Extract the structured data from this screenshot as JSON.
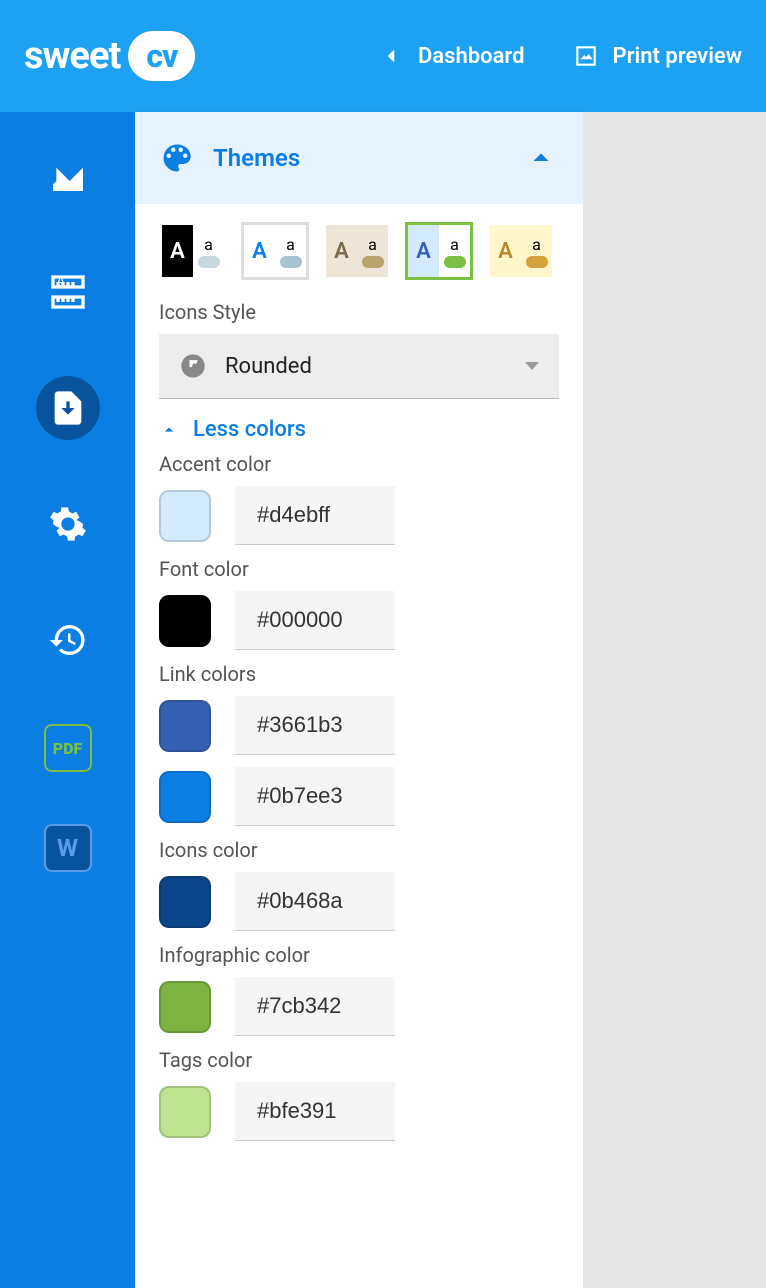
{
  "header": {
    "logo_text": "sweet",
    "logo_badge": "cv",
    "dashboard": "Dashboard",
    "print_preview": "Print preview"
  },
  "panel": {
    "title": "Themes",
    "icons_style_label": "Icons Style",
    "icons_style_value": "Rounded",
    "less_colors": "Less colors",
    "themes": [
      {
        "leftBg": "#000000",
        "leftColor": "#ffffff",
        "rightBg": "#ffffff",
        "pillBg": "#c7d7dd"
      },
      {
        "leftBg": "#ffffff",
        "leftColor": "#0b7ee3",
        "rightBg": "#ffffff",
        "pillBg": "#a8c3d0",
        "border": "#ddd"
      },
      {
        "leftBg": "#ece5d8",
        "leftColor": "#7a6b4f",
        "rightBg": "#ece5d8",
        "pillBg": "#b8a56b"
      },
      {
        "leftBg": "#d4ebff",
        "leftColor": "#3661b3",
        "rightBg": "#ffffff",
        "pillBg": "#7bc043",
        "selected": true
      },
      {
        "leftBg": "#fff6cc",
        "leftColor": "#b88a2b",
        "rightBg": "#fff6cc",
        "pillBg": "#d4a13a"
      }
    ],
    "colors": [
      {
        "label": "Accent color",
        "rows": [
          {
            "hex": "#d4ebff"
          }
        ]
      },
      {
        "label": "Font color",
        "rows": [
          {
            "hex": "#000000"
          }
        ]
      },
      {
        "label": "Link colors",
        "rows": [
          {
            "hex": "#3661b3"
          },
          {
            "hex": "#0b7ee3"
          }
        ]
      },
      {
        "label": "Icons color",
        "rows": [
          {
            "hex": "#0b468a"
          }
        ]
      },
      {
        "label": "Infographic color",
        "rows": [
          {
            "hex": "#7cb342"
          }
        ]
      },
      {
        "label": "Tags color",
        "rows": [
          {
            "hex": "#bfe391"
          }
        ]
      }
    ]
  }
}
